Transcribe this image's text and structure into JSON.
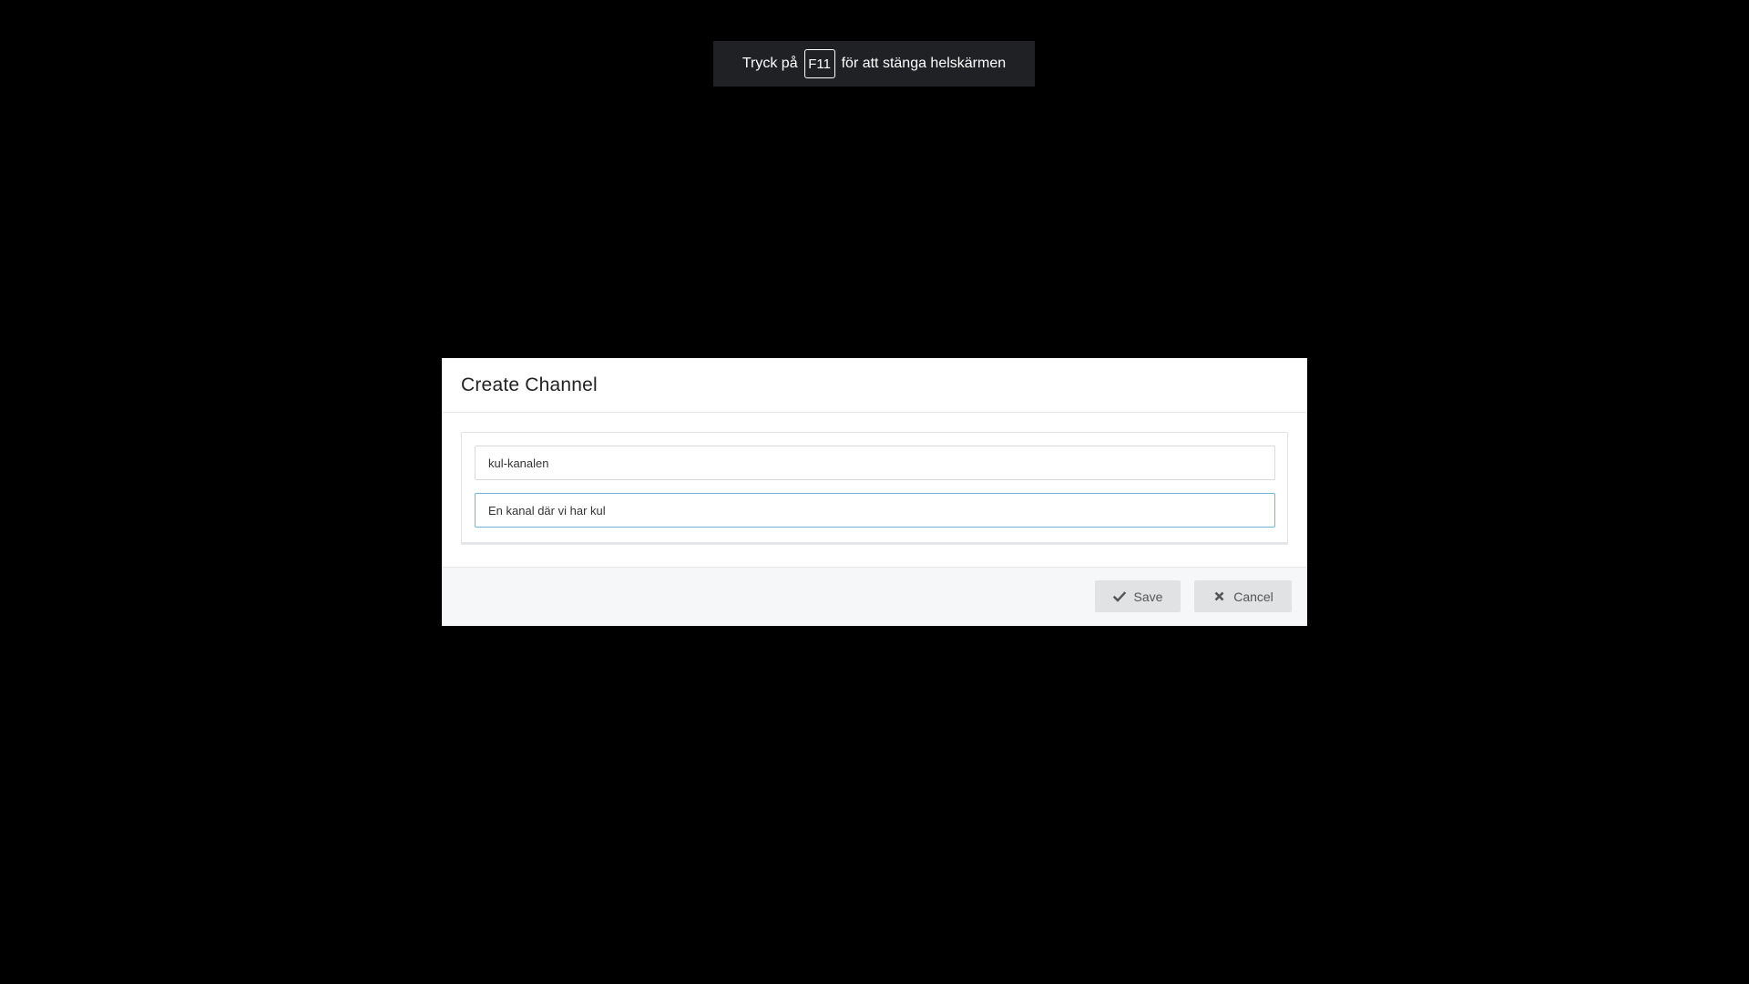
{
  "fullscreen_notice": {
    "prefix": "Tryck på",
    "key": "F11",
    "suffix": "för att stänga helskärmen"
  },
  "modal": {
    "title": "Create Channel",
    "fields": {
      "name": {
        "value": "kul-kanalen"
      },
      "purpose": {
        "value": "En kanal där vi har kul"
      }
    },
    "buttons": {
      "save_label": "Save",
      "save_icon": "check-icon",
      "cancel_label": "Cancel",
      "cancel_icon": "close-icon"
    }
  },
  "colors": {
    "backdrop": "#000000",
    "toast_background": "#1f2124",
    "focus_border": "#6cb5dc",
    "button_background": "#e1e2e3",
    "footer_background": "#f6f7f8"
  }
}
